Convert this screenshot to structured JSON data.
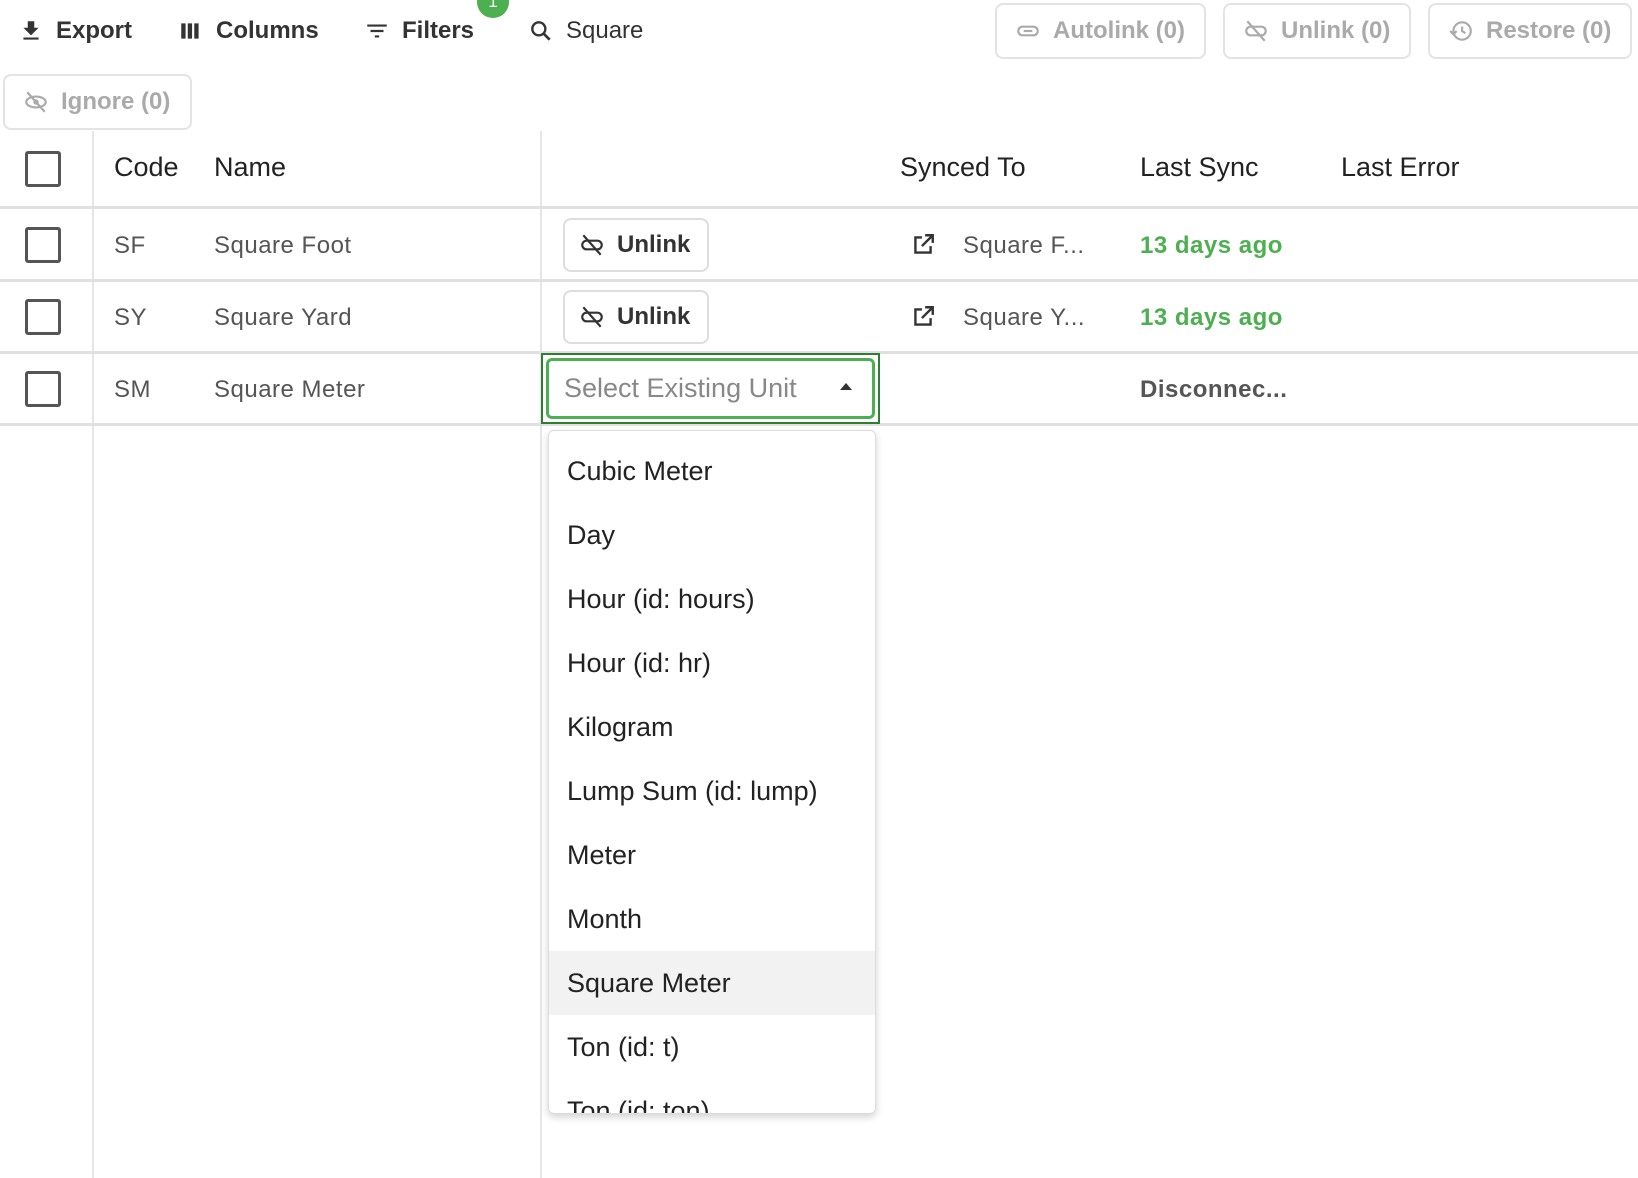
{
  "toolbar": {
    "export": "Export",
    "columns": "Columns",
    "filters": "Filters",
    "filter_count": "1",
    "search": "Square",
    "autolink": "Autolink (0)",
    "unlink": "Unlink (0)",
    "restore": "Restore (0)",
    "ignore": "Ignore (0)"
  },
  "table": {
    "headers": {
      "code": "Code",
      "name": "Name",
      "synced_to": "Synced To",
      "last_sync": "Last Sync",
      "last_error": "Last Error"
    },
    "rows": [
      {
        "code": "SF",
        "name": "Square Foot",
        "action": "Unlink",
        "synced_to": "Square F...",
        "last_sync": "13 days ago"
      },
      {
        "code": "SY",
        "name": "Square Yard",
        "action": "Unlink",
        "synced_to": "Square Y...",
        "last_sync": "13 days ago"
      },
      {
        "code": "SM",
        "name": "Square Meter",
        "select_placeholder": "Select Existing Unit",
        "last_sync": "Disconnec..."
      }
    ]
  },
  "dropdown": {
    "options": [
      "Cubic Meter",
      "Day",
      "Hour (id: hours)",
      "Hour (id: hr)",
      "Kilogram",
      "Lump Sum (id: lump)",
      "Meter",
      "Month",
      "Square Meter",
      "Ton (id: t)",
      "Ton (id: ton)"
    ],
    "highlighted": "Square Meter"
  },
  "colors": {
    "accent": "#4caf50",
    "border_focus": "#2e7d32"
  }
}
